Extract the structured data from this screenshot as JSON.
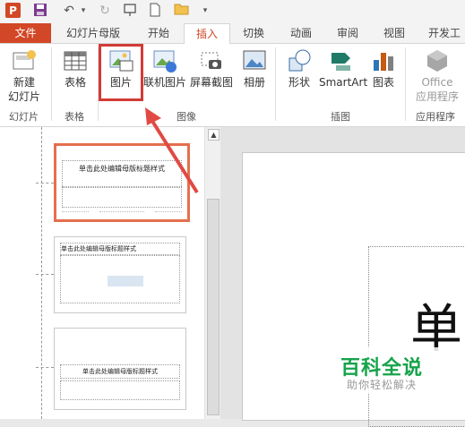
{
  "qat": {
    "logo_text": "P",
    "icons": [
      "save-icon",
      "undo-icon",
      "redo-icon",
      "presenter-icon",
      "new-file-icon",
      "open-folder-icon",
      "customize-dropdown-icon"
    ]
  },
  "tabs": [
    "文件",
    "幻灯片母版",
    "开始",
    "插入",
    "切换",
    "动画",
    "审阅",
    "视图",
    "开发工"
  ],
  "ribbon": {
    "new_slide_label_1": "新建",
    "new_slide_label_2": "幻灯片",
    "group_slides": "幻灯片",
    "table_label": "表格",
    "group_tables": "表格",
    "picture_label": "图片",
    "online_picture_label": "联机图片",
    "screenshot_label": "屏幕截图",
    "album_label": "相册",
    "group_images": "图像",
    "shapes_label": "形状",
    "smartart_label": "SmartArt",
    "chart_label": "图表",
    "group_illustrations": "插图",
    "office_label_1": "Office",
    "office_label_2": "应用程序",
    "group_apps": "应用程序",
    "accent": "#d24726",
    "highlight_color": "#d23b36"
  },
  "thumbnails": {
    "t1_title": "单击此处编辑母版标题样式",
    "t2_title": "单击此处编辑母版标题样式",
    "t3_title": "单击此处编辑母版标题样式"
  },
  "slide": {
    "title_char": "单"
  },
  "watermark": {
    "line1": "百科全说",
    "line2": "助你轻松解决"
  }
}
